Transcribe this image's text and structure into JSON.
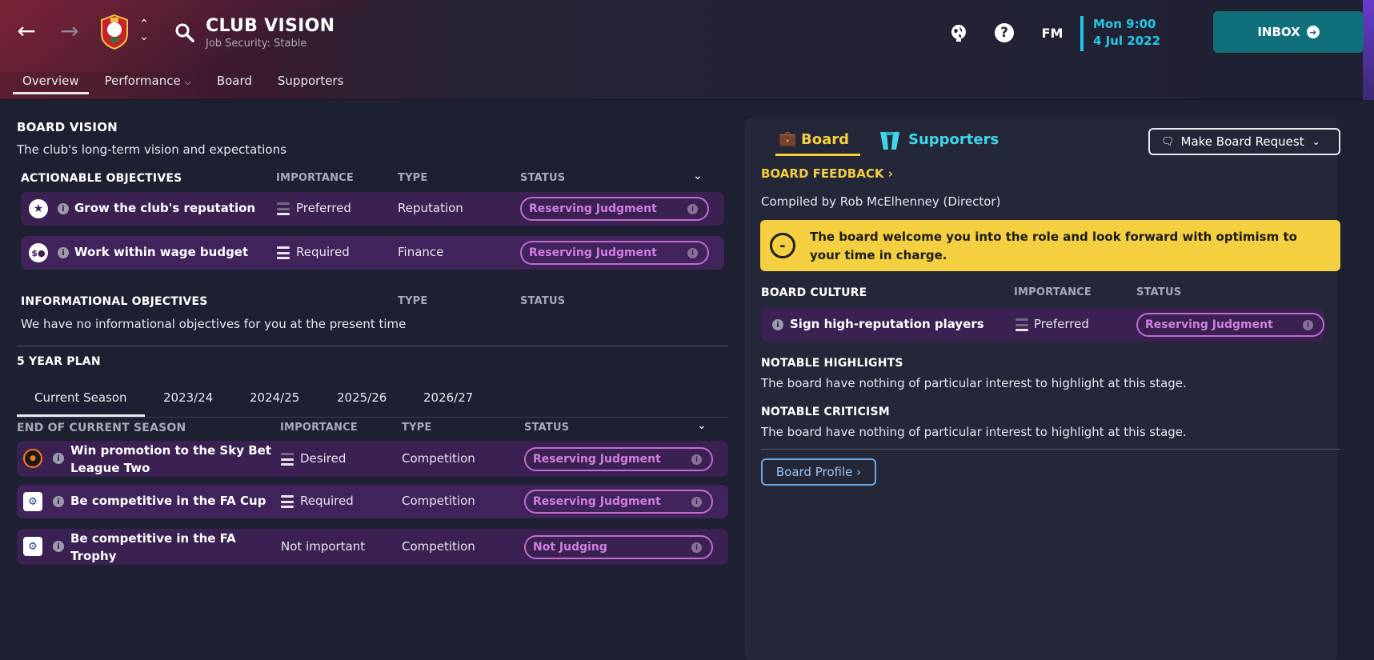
{
  "header": {
    "title": "CLUB VISION",
    "subtitle": "Job Security: Stable",
    "tabs": [
      {
        "label": "Overview"
      },
      {
        "label": "Performance",
        "has_dropdown": true
      },
      {
        "label": "Board"
      },
      {
        "label": "Supporters"
      }
    ],
    "date_day_time": "Mon 9:00",
    "date": "4 Jul 2022",
    "inbox_label": "INBOX",
    "fm_label": "FM",
    "accent_color": "#22c9e6"
  },
  "board_vision": {
    "title": "BOARD VISION",
    "description": "The club's long-term vision and expectations",
    "actionable": {
      "header": "ACTIONABLE OBJECTIVES",
      "col_importance": "IMPORTANCE",
      "col_type": "TYPE",
      "col_status": "STATUS",
      "rows": [
        {
          "icon": "star-icon",
          "objective": "Grow the club's reputation",
          "importance": "Preferred",
          "importance_level": 1,
          "type": "Reputation",
          "status": "Reserving Judgment"
        },
        {
          "icon": "wage-icon",
          "objective": "Work within wage budget",
          "importance": "Required",
          "importance_level": 3,
          "type": "Finance",
          "status": "Reserving Judgment"
        }
      ]
    },
    "informational": {
      "header": "INFORMATIONAL OBJECTIVES",
      "col_type": "TYPE",
      "col_status": "STATUS",
      "empty_text": "We have no informational objectives for you at the present time"
    }
  },
  "five_year_plan": {
    "title": "5 YEAR PLAN",
    "tabs": [
      "Current Season",
      "2023/24",
      "2024/25",
      "2025/26",
      "2026/27"
    ],
    "section_header": "END OF CURRENT SEASON",
    "col_importance": "IMPORTANCE",
    "col_type": "TYPE",
    "col_status": "STATUS",
    "rows": [
      {
        "icon": "league-two-icon",
        "objective_line1": "Win promotion to the Sky Bet",
        "objective_line2": "League Two",
        "importance": "Desired",
        "importance_level": 2,
        "type": "Competition",
        "status": "Reserving Judgment"
      },
      {
        "icon": "fa-cup-icon",
        "objective_line1": "Be competitive in the FA Cup",
        "objective_line2": "",
        "importance": "Required",
        "importance_level": 3,
        "type": "Competition",
        "status": "Reserving Judgment"
      },
      {
        "icon": "fa-trophy-icon",
        "objective_line1": "Be competitive in the FA",
        "objective_line2": "Trophy",
        "importance": "Not important",
        "importance_level": 0,
        "type": "Competition",
        "status": "Not Judging"
      }
    ]
  },
  "right_panel": {
    "tab_board": "Board",
    "tab_supporters": "Supporters",
    "request_button": "Make Board Request",
    "feedback_title": "BOARD FEEDBACK",
    "compiled_by": "Compiled by Rob McElhenney (Director)",
    "feedback_text": "The board welcome you into the role and look forward with optimism to your time in charge.",
    "feedback_symbol": "-",
    "culture": {
      "header": "BOARD CULTURE",
      "col_importance": "IMPORTANCE",
      "col_status": "STATUS",
      "row": {
        "objective": "Sign high-reputation players",
        "importance": "Preferred",
        "importance_level": 1,
        "status": "Reserving Judgment"
      }
    },
    "highlights_title": "NOTABLE HIGHLIGHTS",
    "highlights_text": "The board have nothing of particular interest to highlight at this stage.",
    "criticism_title": "NOTABLE CRITICISM",
    "criticism_text": "The board have nothing of particular interest to highlight at this stage.",
    "profile_button": "Board Profile",
    "board_color": "#f4cf3f",
    "supporters_color": "#3fd6ea"
  }
}
